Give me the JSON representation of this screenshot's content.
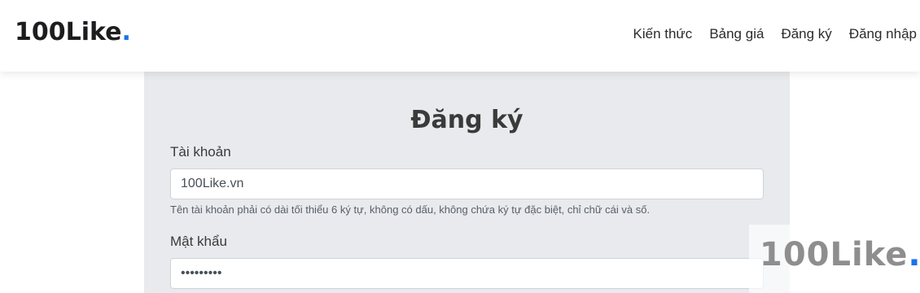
{
  "header": {
    "logo_text": "100Like",
    "logo_dot": ".",
    "nav": [
      "Kiến thức",
      "Bảng giá",
      "Đăng ký",
      "Đăng nhập"
    ]
  },
  "form": {
    "title": "Đăng ký",
    "account_label": "Tài khoản",
    "account_value": "100Like.vn",
    "account_help": "Tên tài khoản phải có dài tối thiểu 6 ký tự, không có dấu, không chứa ký tự đặc biệt, chỉ chữ cái và số.",
    "password_label": "Mật khẩu",
    "password_value": "123456789"
  },
  "watermark": {
    "text": "100Like",
    "dot": "."
  },
  "colors": {
    "accent": "#1a73e8",
    "panel_bg": "#e8eaed"
  }
}
